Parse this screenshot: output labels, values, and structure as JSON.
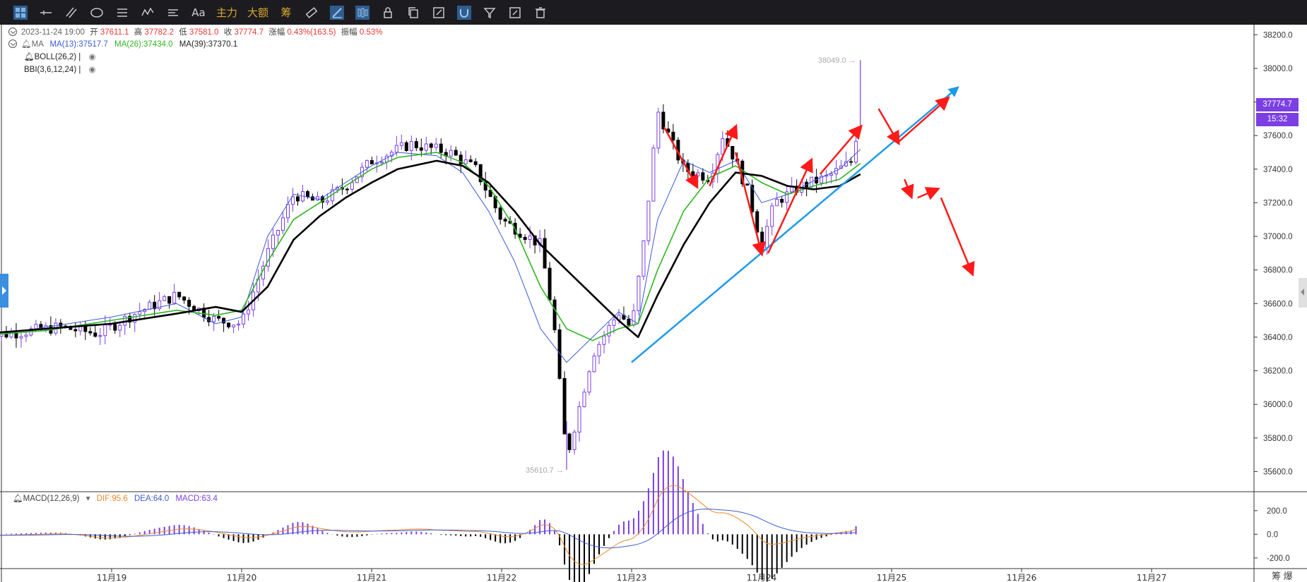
{
  "toolbar": {
    "items": [
      {
        "name": "layout-icon",
        "active": true
      },
      {
        "name": "horizontal-line-icon"
      },
      {
        "name": "parallel-line-icon"
      },
      {
        "name": "ellipse-icon"
      },
      {
        "name": "fib-icon"
      },
      {
        "name": "wave-icon"
      },
      {
        "name": "range-icon"
      }
    ],
    "text_font": "Aa",
    "label_main": "主力",
    "label_big": "大额",
    "label_chip": "筹",
    "tools": [
      {
        "name": "ruler-icon"
      },
      {
        "name": "brush-icon",
        "active": true
      },
      {
        "name": "candle-icon",
        "active": true
      },
      {
        "name": "lock-icon"
      },
      {
        "name": "copy-icon"
      },
      {
        "name": "edit-icon"
      },
      {
        "name": "magnet-icon",
        "active": true
      },
      {
        "name": "filter-icon"
      },
      {
        "name": "sync-icon"
      },
      {
        "name": "trash-icon"
      }
    ]
  },
  "info": {
    "datetime": "2023-11-24 19:00",
    "open_label": "开",
    "open": "37611.1",
    "high_label": "高",
    "high": "37782.2",
    "low_label": "低",
    "low": "37581.0",
    "close_label": "收",
    "close": "37774.7",
    "change_label": "涨幅",
    "change": "0.43%(163.5)",
    "amp_label": "振幅",
    "amp": "0.53%",
    "ma_label": "MA",
    "ma13": "MA(13):37517.7",
    "ma26": "MA(26):37434.0",
    "ma39": "MA(39):37370.1",
    "boll": "BOLL(26,2)",
    "bbi": "BBI(3,6,12,24)",
    "macd_label": "MACD(12,26,9)",
    "dif": "DIF:95.6",
    "dea": "DEA:64.0",
    "macd": "MACD:63.4"
  },
  "colors": {
    "ma13": "#3b5bd6",
    "ma26": "#2fb521",
    "ma39": "#000000",
    "candle": "#7b3fe4",
    "candle_dark": "#000000",
    "arrow_red": "#ff1a1a",
    "trend_blue": "#1e9be8",
    "dif": "#f08a24",
    "dea": "#3b5bd6"
  },
  "price_tag": "37774.7",
  "time_tag": "15:32",
  "bottom_right": "筹 爆",
  "chart_data": {
    "type": "candlestick",
    "y_axis": {
      "ticks": [
        38200,
        38000,
        37800,
        37600,
        37400,
        37200,
        37000,
        36800,
        36600,
        36400,
        36200,
        36000,
        35800,
        35600
      ],
      "range": [
        35480,
        38260
      ]
    },
    "x_axis": {
      "ticks": [
        "11月19",
        "11月20",
        "11月21",
        "11月22",
        "11月23",
        "11月24",
        "11月25",
        "11月26",
        "11月27"
      ]
    },
    "high_mark": "38049.0",
    "low_mark": "35610.7",
    "close_path": [
      [
        18.0,
        36400
      ],
      [
        18.3,
        36430
      ],
      [
        18.6,
        36460
      ],
      [
        18.9,
        36420
      ],
      [
        19.2,
        36550
      ],
      [
        19.5,
        36650
      ],
      [
        19.8,
        36500
      ],
      [
        20.0,
        36480
      ],
      [
        20.2,
        36900
      ],
      [
        20.4,
        37250
      ],
      [
        20.6,
        37200
      ],
      [
        20.8,
        37300
      ],
      [
        21.0,
        37450
      ],
      [
        21.3,
        37550
      ],
      [
        21.6,
        37500
      ],
      [
        21.8,
        37400
      ],
      [
        22.0,
        37100
      ],
      [
        22.3,
        36950
      ],
      [
        22.4,
        36500
      ],
      [
        22.5,
        35680
      ],
      [
        22.7,
        36300
      ],
      [
        22.9,
        36550
      ],
      [
        23.0,
        36450
      ],
      [
        23.1,
        37000
      ],
      [
        23.2,
        37750
      ],
      [
        23.4,
        37400
      ],
      [
        23.6,
        37350
      ],
      [
        23.7,
        37600
      ],
      [
        23.8,
        37450
      ],
      [
        23.9,
        37250
      ],
      [
        24.0,
        36950
      ],
      [
        24.1,
        37200
      ],
      [
        24.3,
        37300
      ],
      [
        24.5,
        37350
      ],
      [
        24.7,
        37450
      ],
      [
        24.76,
        37774
      ]
    ],
    "ma39_path": [
      [
        18.0,
        36420
      ],
      [
        18.5,
        36450
      ],
      [
        19.0,
        36480
      ],
      [
        19.5,
        36540
      ],
      [
        19.8,
        36580
      ],
      [
        20.0,
        36550
      ],
      [
        20.2,
        36700
      ],
      [
        20.4,
        36980
      ],
      [
        20.6,
        37120
      ],
      [
        20.8,
        37230
      ],
      [
        21.0,
        37320
      ],
      [
        21.2,
        37400
      ],
      [
        21.5,
        37450
      ],
      [
        21.7,
        37420
      ],
      [
        21.9,
        37320
      ],
      [
        22.1,
        37150
      ],
      [
        22.3,
        36950
      ],
      [
        22.5,
        36800
      ],
      [
        22.7,
        36650
      ],
      [
        22.9,
        36500
      ],
      [
        23.05,
        36400
      ],
      [
        23.2,
        36650
      ],
      [
        23.4,
        36950
      ],
      [
        23.6,
        37200
      ],
      [
        23.8,
        37380
      ],
      [
        24.0,
        37360
      ],
      [
        24.2,
        37300
      ],
      [
        24.4,
        37280
      ],
      [
        24.6,
        37300
      ],
      [
        24.76,
        37370
      ]
    ],
    "ma26_path": [
      [
        18.0,
        36410
      ],
      [
        18.5,
        36440
      ],
      [
        19.0,
        36500
      ],
      [
        19.5,
        36560
      ],
      [
        19.8,
        36530
      ],
      [
        20.0,
        36560
      ],
      [
        20.2,
        36850
      ],
      [
        20.4,
        37100
      ],
      [
        20.6,
        37200
      ],
      [
        20.8,
        37300
      ],
      [
        21.0,
        37400
      ],
      [
        21.2,
        37470
      ],
      [
        21.5,
        37500
      ],
      [
        21.7,
        37440
      ],
      [
        21.9,
        37300
      ],
      [
        22.1,
        37050
      ],
      [
        22.3,
        36700
      ],
      [
        22.5,
        36450
      ],
      [
        22.7,
        36380
      ],
      [
        22.9,
        36450
      ],
      [
        23.05,
        36480
      ],
      [
        23.2,
        36800
      ],
      [
        23.4,
        37150
      ],
      [
        23.6,
        37350
      ],
      [
        23.8,
        37420
      ],
      [
        24.0,
        37320
      ],
      [
        24.2,
        37250
      ],
      [
        24.4,
        37300
      ],
      [
        24.6,
        37340
      ],
      [
        24.76,
        37434
      ]
    ],
    "ma13_path": [
      [
        18.0,
        36400
      ],
      [
        18.5,
        36460
      ],
      [
        19.0,
        36520
      ],
      [
        19.5,
        36600
      ],
      [
        19.8,
        36480
      ],
      [
        20.0,
        36520
      ],
      [
        20.2,
        37000
      ],
      [
        20.4,
        37250
      ],
      [
        20.6,
        37220
      ],
      [
        20.8,
        37320
      ],
      [
        21.0,
        37420
      ],
      [
        21.2,
        37500
      ],
      [
        21.5,
        37480
      ],
      [
        21.7,
        37380
      ],
      [
        21.9,
        37150
      ],
      [
        22.1,
        36850
      ],
      [
        22.3,
        36450
      ],
      [
        22.5,
        36250
      ],
      [
        22.7,
        36400
      ],
      [
        22.9,
        36550
      ],
      [
        23.05,
        36480
      ],
      [
        23.2,
        37100
      ],
      [
        23.4,
        37450
      ],
      [
        23.6,
        37380
      ],
      [
        23.8,
        37450
      ],
      [
        24.0,
        37200
      ],
      [
        24.2,
        37250
      ],
      [
        24.4,
        37330
      ],
      [
        24.6,
        37400
      ],
      [
        24.76,
        37518
      ]
    ],
    "trendline": {
      "from": [
        23.0,
        36250
      ],
      "to": [
        25.5,
        37880
      ]
    },
    "annotations_arrows": [
      {
        "from": [
          23.25,
          37650
        ],
        "to": [
          23.5,
          37300
        ]
      },
      {
        "from": [
          23.6,
          37300
        ],
        "to": [
          23.8,
          37650
        ]
      },
      {
        "from": [
          23.8,
          37500
        ],
        "to": [
          24.0,
          36900
        ]
      },
      {
        "from": [
          24.05,
          36900
        ],
        "to": [
          24.38,
          37450
        ]
      },
      {
        "from": [
          24.45,
          37370
        ],
        "to": [
          24.76,
          37650
        ]
      },
      {
        "from": [
          24.9,
          37760
        ],
        "to": [
          25.05,
          37560
        ]
      },
      {
        "from": [
          25.05,
          37560
        ],
        "to": [
          25.43,
          37820
        ]
      },
      {
        "from": [
          25.1,
          37340
        ],
        "to": [
          25.15,
          37240
        ]
      },
      {
        "from": [
          25.2,
          37230
        ],
        "to": [
          25.35,
          37280
        ]
      },
      {
        "from": [
          25.38,
          37230
        ],
        "to": [
          25.62,
          36780
        ]
      }
    ],
    "macd": {
      "y_ticks": [
        200.0,
        0.0,
        -200.0
      ],
      "range": [
        -290,
        360
      ]
    }
  }
}
